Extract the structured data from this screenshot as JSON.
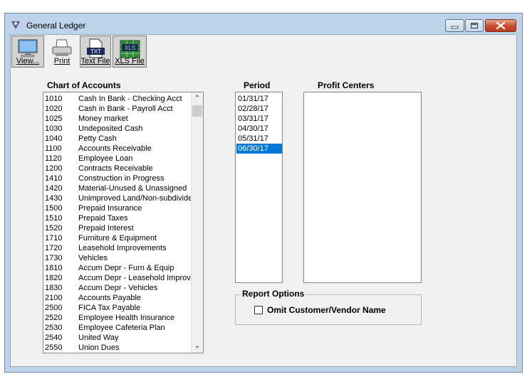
{
  "window": {
    "title": "General Ledger"
  },
  "toolbar": {
    "view_label": "View...",
    "print_label": "Print",
    "text_file_label": "Text File",
    "text_file_icon_text": "TXT",
    "xls_file_label": "XLS File",
    "xls_file_icon_text": "XLS"
  },
  "chart_of_accounts": {
    "heading": "Chart of Accounts",
    "rows": [
      {
        "num": "1010",
        "name": "Cash In Bank - Checking Acct"
      },
      {
        "num": "1020",
        "name": "Cash in Bank - Payroll Acct"
      },
      {
        "num": "1025",
        "name": "Money market"
      },
      {
        "num": "1030",
        "name": "Undeposited Cash"
      },
      {
        "num": "1040",
        "name": "Petty Cash"
      },
      {
        "num": "1100",
        "name": "Accounts Receivable"
      },
      {
        "num": "1120",
        "name": "Employee Loan"
      },
      {
        "num": "1200",
        "name": "Contracts Receivable"
      },
      {
        "num": "1410",
        "name": "Construction in Progress"
      },
      {
        "num": "1420",
        "name": "Material-Unused & Unassigned"
      },
      {
        "num": "1430",
        "name": "Unimproved Land/Non-subdividec"
      },
      {
        "num": "1500",
        "name": "Prepaid Insurance"
      },
      {
        "num": "1510",
        "name": "Prepaid Taxes"
      },
      {
        "num": "1520",
        "name": "Prepaid Interest"
      },
      {
        "num": "1710",
        "name": "Furniture & Equipment"
      },
      {
        "num": "1720",
        "name": "Leasehold Improvements"
      },
      {
        "num": "1730",
        "name": "Vehicles"
      },
      {
        "num": "1810",
        "name": "Accum Depr - Furn & Equip"
      },
      {
        "num": "1820",
        "name": "Accum Depr - Leasehold Improv"
      },
      {
        "num": "1830",
        "name": "Accum Depr - Vehicles"
      },
      {
        "num": "2100",
        "name": "Accounts Payable"
      },
      {
        "num": "2500",
        "name": "FICA Tax Payable"
      },
      {
        "num": "2520",
        "name": "Employee Health Insurance"
      },
      {
        "num": "2530",
        "name": "Employee Cafeteria Plan"
      },
      {
        "num": "2540",
        "name": "United Way"
      },
      {
        "num": "2550",
        "name": "Union Dues"
      }
    ]
  },
  "period": {
    "heading": "Period",
    "items": [
      "01/31/17",
      "02/28/17",
      "03/31/17",
      "04/30/17",
      "05/31/17",
      "06/30/17"
    ],
    "selected": "06/30/17"
  },
  "profit_centers": {
    "heading": "Profit Centers"
  },
  "report_options": {
    "title": "Report Options",
    "omit_label": "Omit Customer/Vendor Name",
    "omit_checked": false
  },
  "colors": {
    "selection": "#0078d7",
    "close_button": "#c74a2c",
    "window_frame": "#bcd3ea"
  }
}
